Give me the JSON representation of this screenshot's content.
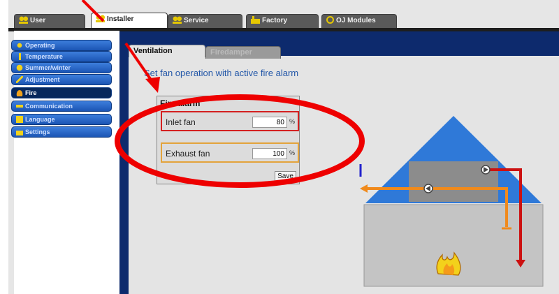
{
  "top_tabs": [
    {
      "label": "User",
      "icon": "user-icon"
    },
    {
      "label": "Installer",
      "icon": "installer-icon",
      "active": true
    },
    {
      "label": "Service",
      "icon": "service-icon"
    },
    {
      "label": "Factory",
      "icon": "factory-icon"
    },
    {
      "label": "OJ Modules",
      "icon": "oj-modules-icon"
    }
  ],
  "sidebar": {
    "items": [
      {
        "label": "Operating",
        "icon": "operating-icon"
      },
      {
        "label": "Temperature",
        "icon": "thermometer-icon"
      },
      {
        "label": "Summer/winter",
        "icon": "sun-icon"
      },
      {
        "label": "Adjustment",
        "icon": "adjustment-icon"
      },
      {
        "label": "Fire",
        "icon": "fire-icon",
        "active": true
      },
      {
        "label": "Communication",
        "icon": "communication-icon"
      },
      {
        "label": "Language",
        "icon": "language-icon"
      },
      {
        "label": "Settings",
        "icon": "settings-icon"
      }
    ]
  },
  "sub_tabs": [
    {
      "label": "Ventilation",
      "active": true
    },
    {
      "label": "Firedamper",
      "active": false
    }
  ],
  "heading": "Set fan operation with active fire alarm",
  "fire_alarm": {
    "title": "Fire alarm",
    "inlet_fan": {
      "label": "Inlet fan",
      "value": "80",
      "unit": "%"
    },
    "exhaust_fan": {
      "label": "Exhaust fan",
      "value": "100",
      "unit": "%"
    },
    "save_label": "Save"
  },
  "colors": {
    "sidebar_blue": "#1b55b4",
    "dark_navy": "#0d2a6d",
    "inlet_highlight": "#d42020",
    "exhaust_highlight": "#e3a33b",
    "roof_blue": "#2f79d8",
    "supply_air": "#cc1111",
    "extract_air": "#f08a1c",
    "annotation_red": "#ee0000"
  }
}
